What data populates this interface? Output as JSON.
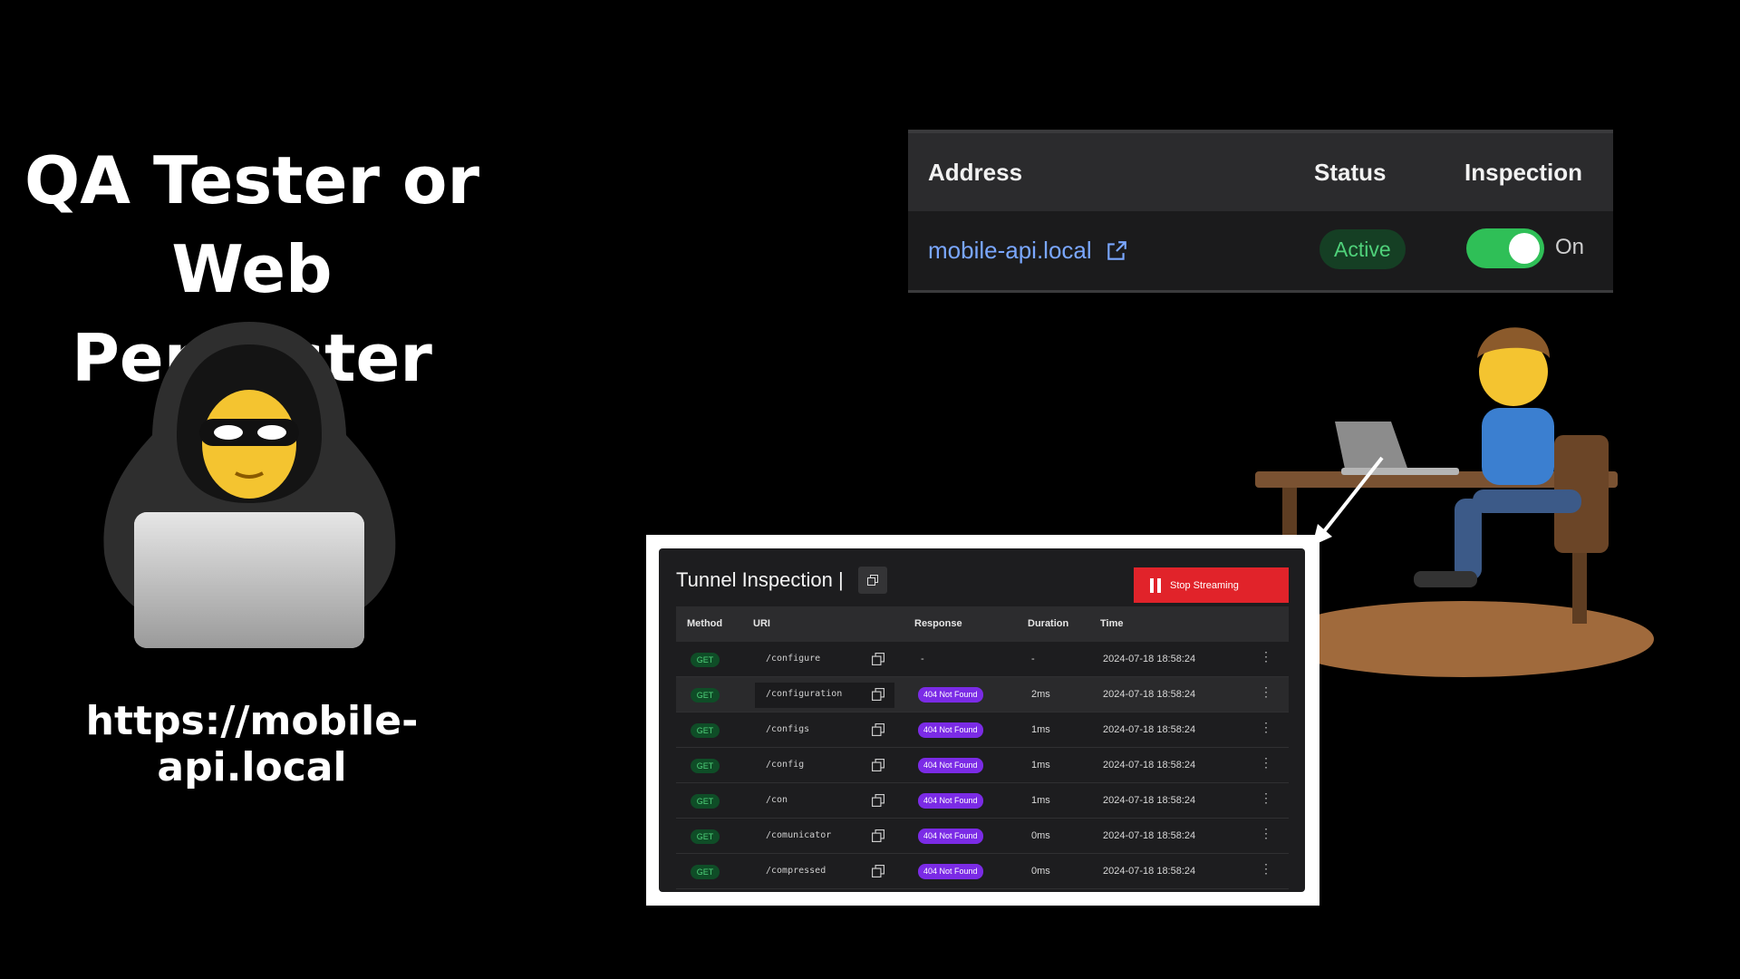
{
  "headline": {
    "line1": "QA Tester or",
    "line2": "Web Pentester"
  },
  "caption_url": "https://mobile-api.local",
  "status_card": {
    "headers": {
      "address": "Address",
      "status": "Status",
      "inspection": "Inspection"
    },
    "address": "mobile-api.local",
    "status": "Active",
    "inspection_on": true,
    "inspection_label": "On",
    "colors": {
      "link": "#7aa7ff",
      "active": "#4fd17a",
      "toggle": "#2fbf57"
    }
  },
  "tunnel": {
    "title": "Tunnel Inspection |",
    "stop_label": "Stop Streaming",
    "columns": {
      "method": "Method",
      "uri": "URI",
      "response": "Response",
      "duration": "Duration",
      "time": "Time"
    },
    "rows": [
      {
        "method": "GET",
        "uri": "/configure",
        "response": "-",
        "duration": "-",
        "time": "2024-07-18 18:58:24"
      },
      {
        "method": "GET",
        "uri": "/configuration",
        "response": "404 Not Found",
        "duration": "2ms",
        "time": "2024-07-18 18:58:24"
      },
      {
        "method": "GET",
        "uri": "/configs",
        "response": "404 Not Found",
        "duration": "1ms",
        "time": "2024-07-18 18:58:24"
      },
      {
        "method": "GET",
        "uri": "/config",
        "response": "404 Not Found",
        "duration": "1ms",
        "time": "2024-07-18 18:58:24"
      },
      {
        "method": "GET",
        "uri": "/con",
        "response": "404 Not Found",
        "duration": "1ms",
        "time": "2024-07-18 18:58:24"
      },
      {
        "method": "GET",
        "uri": "/comunicator",
        "response": "404 Not Found",
        "duration": "0ms",
        "time": "2024-07-18 18:58:24"
      },
      {
        "method": "GET",
        "uri": "/compressed",
        "response": "404 Not Found",
        "duration": "0ms",
        "time": "2024-07-18 18:58:24"
      }
    ],
    "colors": {
      "stop": "#e1232a",
      "response_badge": "#7b2be6",
      "method_badge": "#0f4d27"
    }
  },
  "menu_glyph": "⋮"
}
